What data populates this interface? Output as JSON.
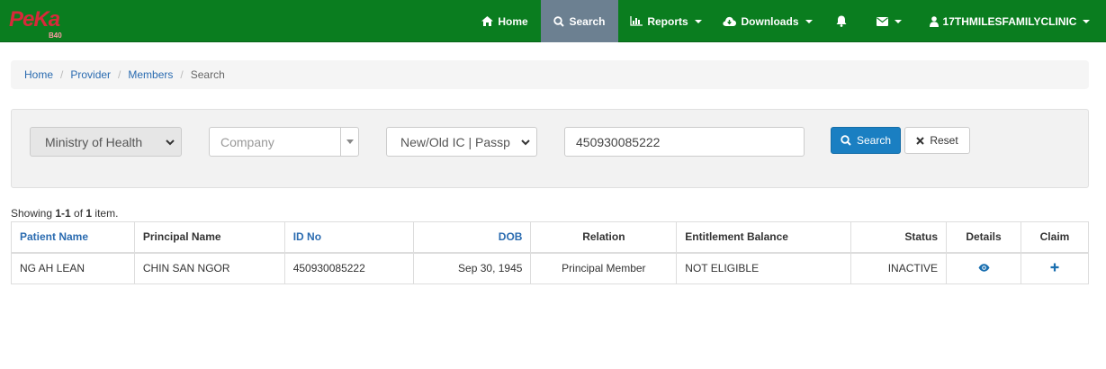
{
  "logo": {
    "text": "PeKa",
    "sub": "B40"
  },
  "nav": {
    "home": "Home",
    "search": "Search",
    "reports": "Reports",
    "downloads": "Downloads",
    "user": "17THMILESFAMILYCLINIC"
  },
  "colors": {
    "navbar": "#0a7d1f",
    "active_nav": "#6c8091",
    "link": "#2a6bb0",
    "primary_button": "#1a7fc2"
  },
  "breadcrumb": {
    "items": [
      "Home",
      "Provider",
      "Members"
    ],
    "current": "Search"
  },
  "filters": {
    "ministry": "Ministry of Health",
    "company_placeholder": "Company",
    "id_type": "New/Old IC | Passp",
    "id_value": "450930085222",
    "search_label": "Search",
    "reset_label": "Reset"
  },
  "summary": {
    "prefix": "Showing ",
    "range": "1-1",
    "middle": " of ",
    "total": "1",
    "suffix": " item."
  },
  "table": {
    "headers": [
      "Patient Name",
      "Principal Name",
      "ID No",
      "DOB",
      "Relation",
      "Entitlement Balance",
      "Status",
      "Details",
      "Claim"
    ],
    "rows": [
      {
        "patient_name": "NG AH LEAN",
        "principal_name": "CHIN SAN NGOR",
        "id_no": "450930085222",
        "dob": "Sep 30, 1945",
        "relation": "Principal Member",
        "entitlement": "NOT ELIGIBLE",
        "status": "INACTIVE",
        "details_icon": "eye-icon",
        "claim_icon": "plus-icon"
      }
    ]
  }
}
